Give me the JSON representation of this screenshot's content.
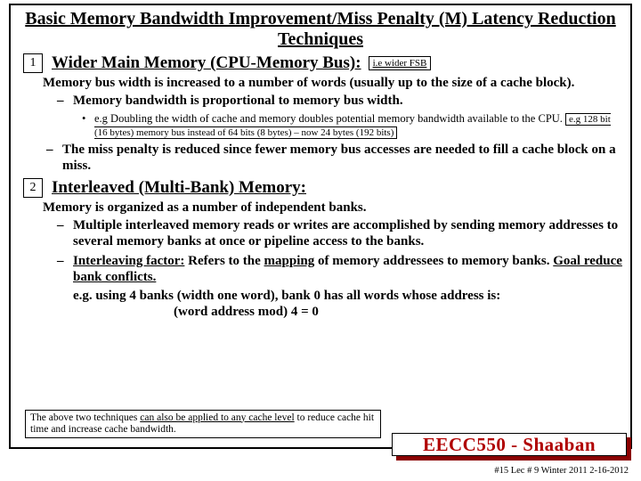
{
  "title": "Basic Memory Bandwidth Improvement/Miss Penalty (M) Latency Reduction Techniques",
  "sec1": {
    "num": "1",
    "heading": "Wider Main Memory (CPU-Memory Bus):",
    "fsb": "i.e wider FSB",
    "p1": "Memory bus width is increased to a number of words  (usually up to the size of a cache block).",
    "d1": "Memory bandwidth is proportional to memory bus width.",
    "b1a": "e.g  Doubling the width of cache and memory doubles potential memory bandwidth available to the CPU.",
    "b1box": "e.g 128 bit (16 bytes) memory bus instead of 64 bits (8 bytes) – now 24 bytes (192 bits)",
    "d2": "The miss penalty is reduced since fewer memory bus accesses are needed to fill a cache block on a miss."
  },
  "sec2": {
    "num": "2",
    "heading": "Interleaved (Multi-Bank) Memory:",
    "p1": "Memory is organized as a number of independent banks.",
    "d1": "Multiple  interleaved memory reads or writes are accomplished by sending memory addresses to several memory banks at once or pipeline access to the banks.",
    "d2a": "Interleaving factor:",
    "d2b": "  Refers to the ",
    "d2c": "mapping",
    "d2d": " of memory addressees to memory banks.   ",
    "d2e": "Goal reduce bank conflicts.",
    "eg1": "e.g.  using 4 banks (width one word), bank 0 has all words whose address  is:",
    "eg2": "(word address mod)  4  =  0"
  },
  "footnote_a": "The above two techniques ",
  "footnote_u": "can also be applied to any cache level",
  "footnote_b": " to reduce cache hit time and increase cache bandwidth.",
  "course": "EECC550 - Shaaban",
  "meta": "#15   Lec # 9  Winter 2011  2-16-2012"
}
